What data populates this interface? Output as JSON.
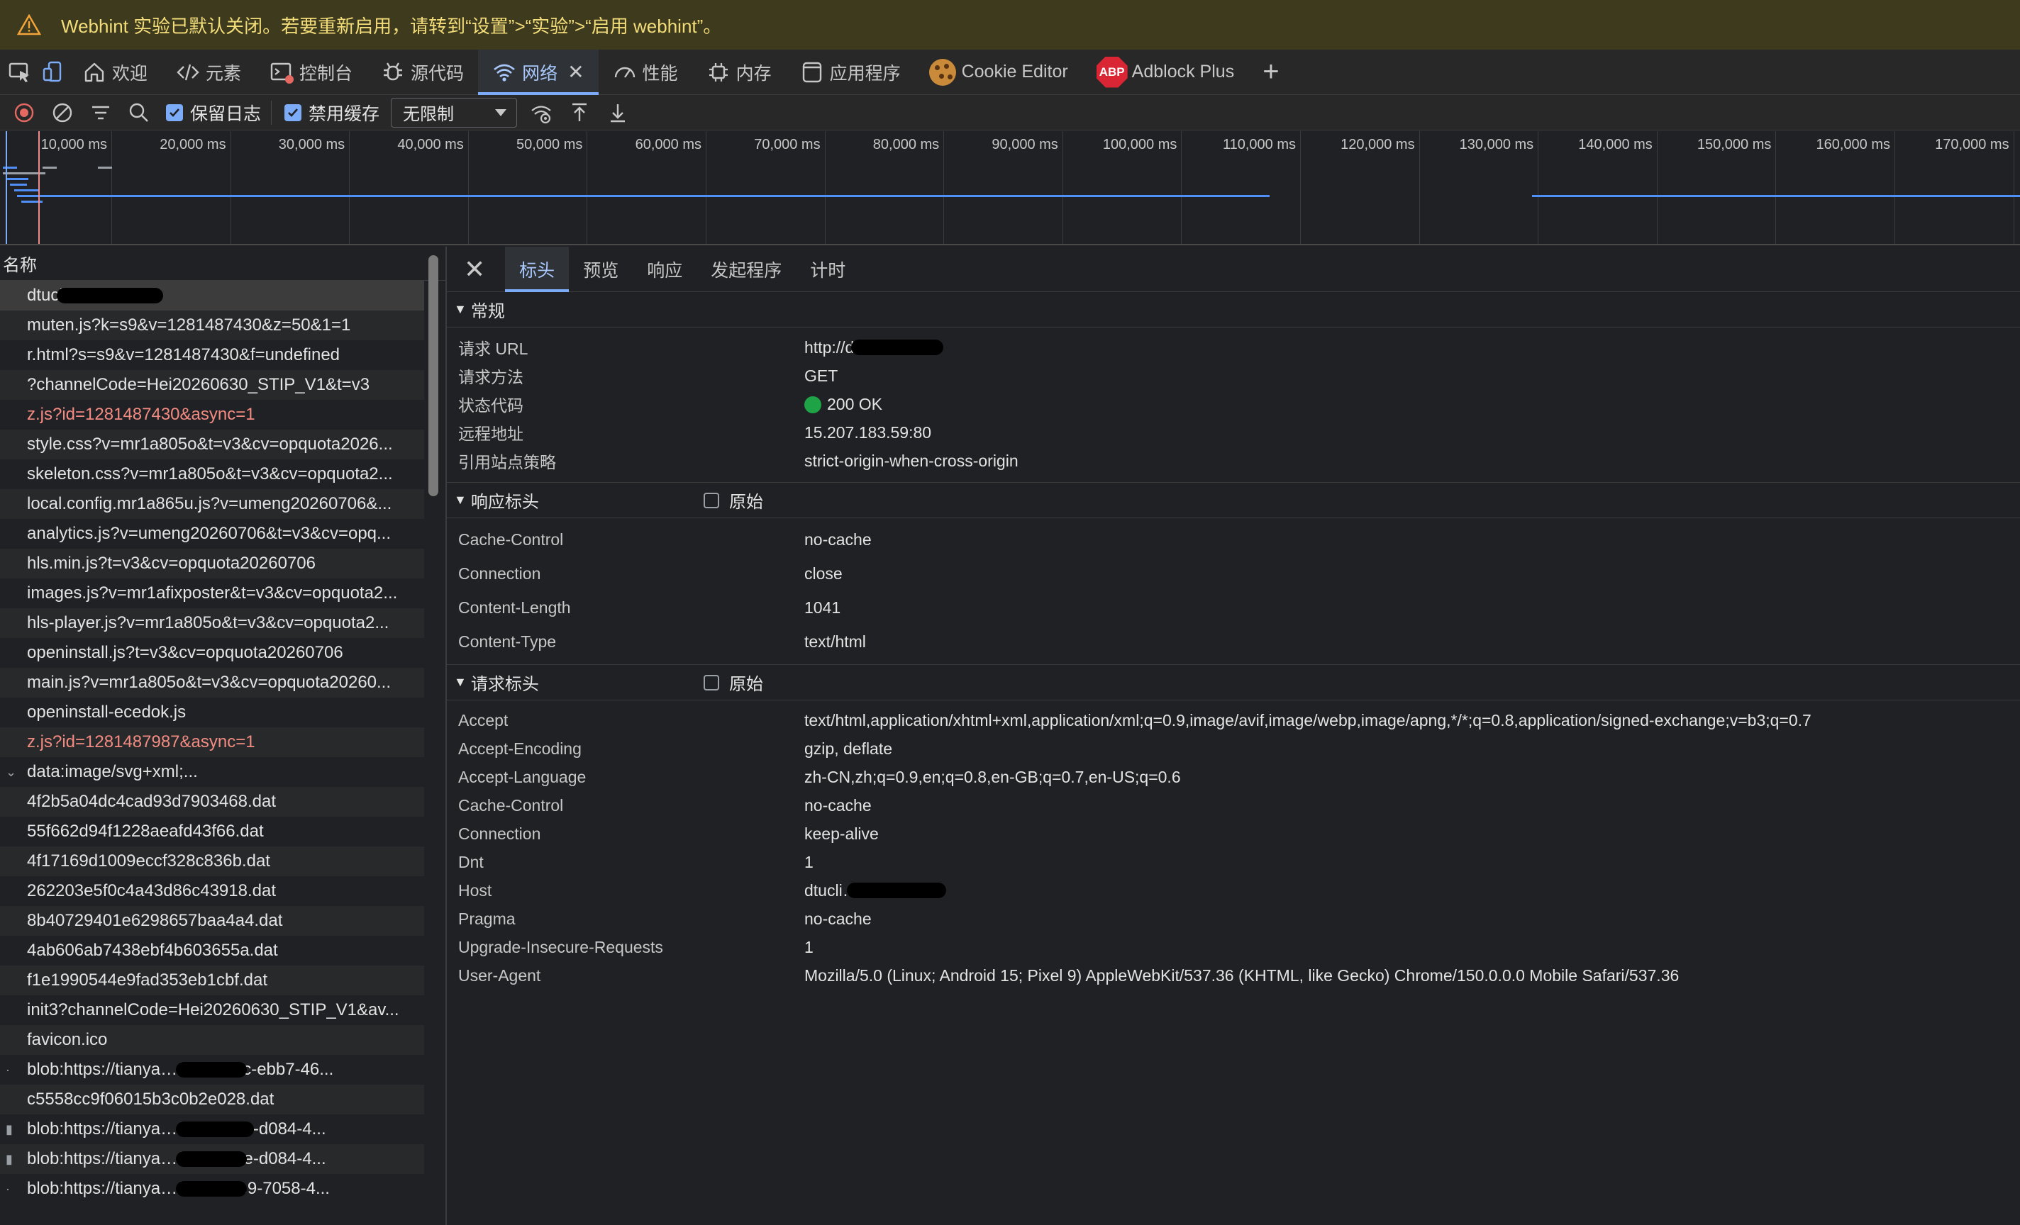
{
  "banner": {
    "text": "Webhint 实验已默认关闭。若要重新启用，请转到“设置”>“实验”>“启用 webhint”。",
    "color": "#f3dd7a"
  },
  "tabs": [
    {
      "label": "欢迎",
      "icon": "home-icon"
    },
    {
      "label": "元素",
      "icon": "code-icon"
    },
    {
      "label": "控制台",
      "icon": "console-icon"
    },
    {
      "label": "源代码",
      "icon": "bug-icon"
    },
    {
      "label": "网络",
      "icon": "wifi-icon",
      "active": true
    },
    {
      "label": "性能",
      "icon": "gauge-icon"
    },
    {
      "label": "内存",
      "icon": "chip-icon"
    },
    {
      "label": "应用程序",
      "icon": "app-icon"
    },
    {
      "label": "Cookie Editor",
      "icon": "cookie-icon"
    },
    {
      "label": "Adblock Plus",
      "icon": "abp-icon",
      "badge": "ABP"
    }
  ],
  "toolbar": {
    "preserve_log": "保留日志",
    "disable_cache": "禁用缓存",
    "throttle": "无限制"
  },
  "timeline": {
    "ticks": [
      "10,000 ms",
      "20,000 ms",
      "30,000 ms",
      "40,000 ms",
      "50,000 ms",
      "60,000 ms",
      "70,000 ms",
      "80,000 ms",
      "90,000 ms",
      "100,000 ms",
      "110,000 ms",
      "120,000 ms",
      "130,000 ms",
      "140,000 ms",
      "150,000 ms",
      "160,000 ms",
      "170,000 ms"
    ]
  },
  "list": {
    "header": "名称",
    "rows": [
      {
        "name": "dtucli…com",
        "sel": true
      },
      {
        "name": "muten.js?k=s9&v=1281487430&z=50&1=1"
      },
      {
        "name": "r.html?s=s9&v=1281487430&f=undefined"
      },
      {
        "name": "?channelCode=Hei20260630_STIP_V1&t=v3"
      },
      {
        "name": "z.js?id=1281487430&async=1",
        "err": true
      },
      {
        "name": "style.css?v=mr1a805o&t=v3&cv=opquota2026..."
      },
      {
        "name": "skeleton.css?v=mr1a805o&t=v3&cv=opquota2..."
      },
      {
        "name": "local.config.mr1a865u.js?v=umeng20260706&..."
      },
      {
        "name": "analytics.js?v=umeng20260706&t=v3&cv=opq..."
      },
      {
        "name": "hls.min.js?t=v3&cv=opquota20260706"
      },
      {
        "name": "images.js?v=mr1afixposter&t=v3&cv=opquota2..."
      },
      {
        "name": "hls-player.js?v=mr1a805o&t=v3&cv=opquota2..."
      },
      {
        "name": "openinstall.js?t=v3&cv=opquota20260706"
      },
      {
        "name": "main.js?v=mr1a805o&t=v3&cv=opquota20260..."
      },
      {
        "name": "openinstall-ecedok.js"
      },
      {
        "name": "z.js?id=1281487987&async=1",
        "err": true
      },
      {
        "name": "data:image/svg+xml;...",
        "ind": "⌄"
      },
      {
        "name": "4f2b5a04dc4cad93d7903468.dat"
      },
      {
        "name": "55f662d94f1228aeafd43f66.dat"
      },
      {
        "name": "4f17169d1009eccf328c836b.dat"
      },
      {
        "name": "262203e5f0c4a43d86c43918.dat"
      },
      {
        "name": "8b40729401e6298657baa4a4.dat"
      },
      {
        "name": "4ab606ab7438ebf4b603655a.dat"
      },
      {
        "name": "f1e1990544e9fad353eb1cbf.dat"
      },
      {
        "name": "init3?channelCode=Hei20260630_STIP_V1&av..."
      },
      {
        "name": "favicon.ico"
      },
      {
        "name": "blob:https://tianya…/1fcea18c-ebb7-46...",
        "ind": "·"
      },
      {
        "name": "c5558cc9f06015b3c0b2e028.dat"
      },
      {
        "name": "blob:https://tianya…/d8a22f5e-d084-4...",
        "ind": "▮"
      },
      {
        "name": "blob:https://tianya…/d8a22f5e-d084-4...",
        "ind": "▮"
      },
      {
        "name": "blob:https://tianya…/3c4053e9-7058-4...",
        "ind": "·"
      }
    ]
  },
  "detail": {
    "tabs": [
      "标头",
      "预览",
      "响应",
      "发起程序",
      "计时"
    ],
    "general": {
      "title": "常规",
      "rows": [
        {
          "k": "请求 URL",
          "v": "http://dtucli…m/"
        },
        {
          "k": "请求方法",
          "v": "GET"
        },
        {
          "k": "状态代码",
          "v": "200 OK"
        },
        {
          "k": "远程地址",
          "v": "15.207.183.59:80"
        },
        {
          "k": "引用站点策略",
          "v": "strict-origin-when-cross-origin"
        }
      ]
    },
    "response": {
      "title": "响应标头",
      "raw": "原始",
      "rows": [
        {
          "k": "Cache-Control",
          "v": "no-cache"
        },
        {
          "k": "Connection",
          "v": "close"
        },
        {
          "k": "Content-Length",
          "v": "1041"
        },
        {
          "k": "Content-Type",
          "v": "text/html"
        }
      ]
    },
    "request": {
      "title": "请求标头",
      "raw": "原始",
      "rows": [
        {
          "k": "Accept",
          "v": "text/html,application/xhtml+xml,application/xml;q=0.9,image/avif,image/webp,image/apng,*/*;q=0.8,application/signed-exchange;v=b3;q=0.7"
        },
        {
          "k": "Accept-Encoding",
          "v": "gzip, deflate"
        },
        {
          "k": "Accept-Language",
          "v": "zh-CN,zh;q=0.9,en;q=0.8,en-GB;q=0.7,en-US;q=0.6"
        },
        {
          "k": "Cache-Control",
          "v": "no-cache"
        },
        {
          "k": "Connection",
          "v": "keep-alive"
        },
        {
          "k": "Dnt",
          "v": "1"
        },
        {
          "k": "Host",
          "v": "dtucli…"
        },
        {
          "k": "Pragma",
          "v": "no-cache"
        },
        {
          "k": "Upgrade-Insecure-Requests",
          "v": "1"
        },
        {
          "k": "User-Agent",
          "v": "Mozilla/5.0 (Linux; Android 15; Pixel 9) AppleWebKit/537.36 (KHTML, like Gecko) Chrome/150.0.0.0 Mobile Safari/537.36"
        }
      ]
    }
  }
}
